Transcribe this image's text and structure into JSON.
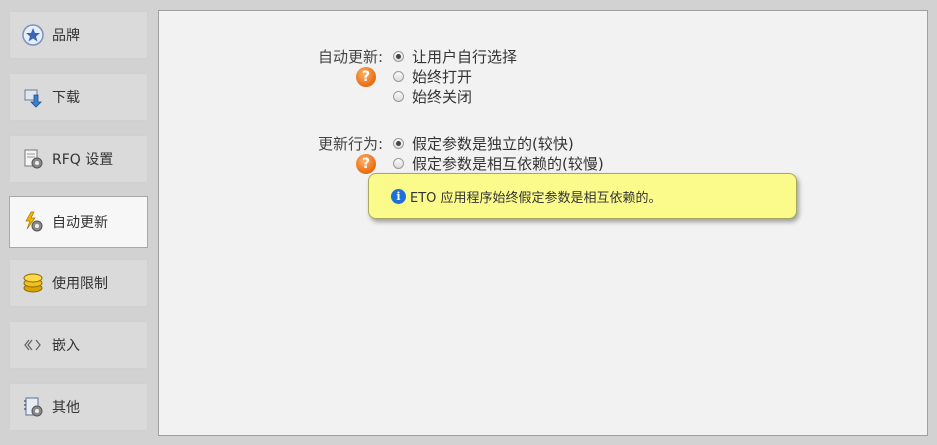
{
  "sidebar": {
    "items": [
      {
        "label": "品牌",
        "icon": "star-badge-icon"
      },
      {
        "label": "下载",
        "icon": "download-icon"
      },
      {
        "label": "RFQ 设置",
        "icon": "rfq-settings-icon"
      },
      {
        "label": "自动更新",
        "icon": "auto-update-icon"
      },
      {
        "label": "使用限制",
        "icon": "coins-icon"
      },
      {
        "label": "嵌入",
        "icon": "embed-code-icon"
      },
      {
        "label": "其他",
        "icon": "notebook-gear-icon"
      }
    ],
    "active_index": 3
  },
  "auto_update": {
    "label": "自动更新:",
    "options": [
      "让用户自行选择",
      "始终打开",
      "始终关闭"
    ],
    "selected": 0
  },
  "update_behavior": {
    "label": "更新行为:",
    "options": [
      "假定参数是独立的(较快)",
      "假定参数是相互依赖的(较慢)"
    ],
    "selected": 0
  },
  "help_icon_text": "?",
  "tooltip": {
    "icon": "info-icon",
    "text": "ETO 应用程序始终假定参数是相互依赖的。"
  }
}
